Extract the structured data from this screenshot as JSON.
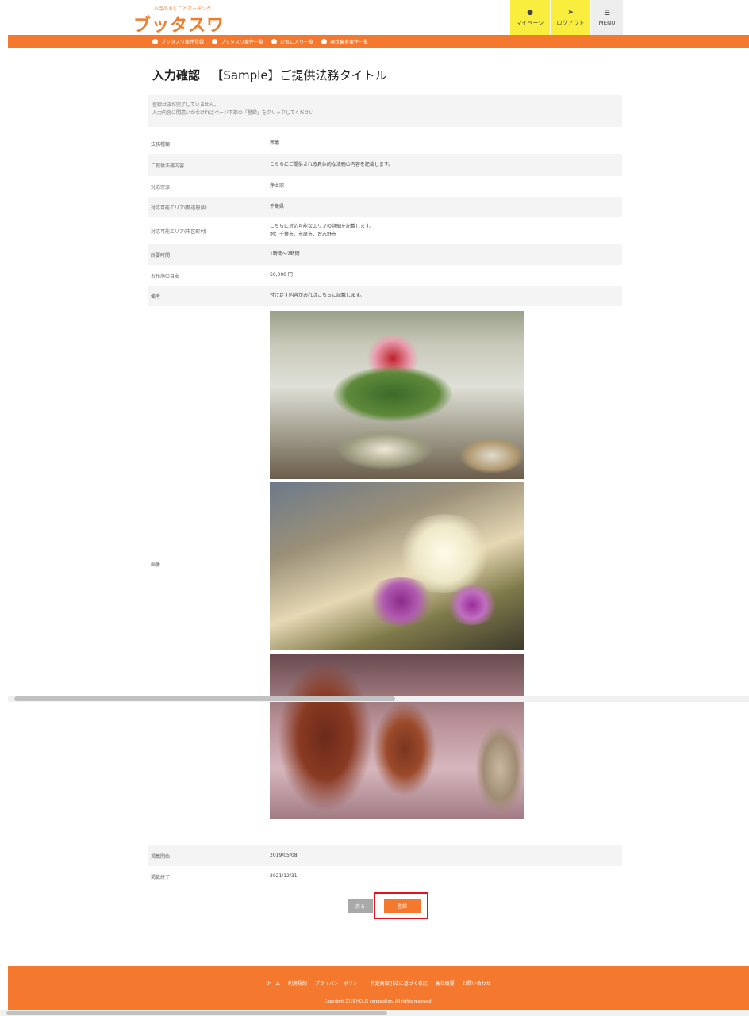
{
  "header": {
    "logo_tagline": "お寺のおしごとマッチング",
    "logo_text": "ブッタスワ",
    "mypage_label": "マイページ",
    "logout_label": "ログアウト",
    "menu_label": "MENU"
  },
  "nav": {
    "items": [
      {
        "label": "ブッタスワ案件登録"
      },
      {
        "label": "ブッタスワ案件一覧"
      },
      {
        "label": "お気に入り一覧"
      },
      {
        "label": "現状審査案件一覧"
      }
    ]
  },
  "page": {
    "title_prefix": "入力確認",
    "title_main": "【Sample】ご提供法務タイトル"
  },
  "notice": {
    "line1": "登録はまだ完了していません。",
    "line2": "入力内容に間違いがなければページ下部の「登録」をクリックしてください"
  },
  "table": {
    "rows": [
      {
        "label": "法務種類",
        "value": "葬儀"
      },
      {
        "label": "ご提供法務内容",
        "value": "こちらにご提供される具体的な法務の内容を記載します。"
      },
      {
        "label": "対応宗派",
        "value": "浄土宗"
      },
      {
        "label": "対応可能エリア(都道府県)",
        "value": "千葉県"
      },
      {
        "label": "対応可能エリア(市区町村)",
        "value": "こちらに対応可能なエリアの詳細を記載します。",
        "value2": "例：千葉市、市原市、習志野市"
      },
      {
        "label": "所要時間",
        "value": "1時間～2時間"
      },
      {
        "label": "お布施の目安",
        "value": "50,000 円"
      },
      {
        "label": "備考",
        "value": "付け足す内容があればこちらに記載します。"
      }
    ],
    "image_label": "画像",
    "images": [
      {
        "alt": "flower-arrangement-incense-photo"
      },
      {
        "alt": "lily-flower-arrangement-photo"
      },
      {
        "alt": "prayer-beads-photo"
      }
    ]
  },
  "dates": [
    {
      "label": "掲載開始",
      "value": "2019/05/08"
    },
    {
      "label": "掲載終了",
      "value": "2021/12/31"
    }
  ],
  "buttons": {
    "back": "戻る",
    "register": "登録"
  },
  "footer": {
    "links": [
      "ホーム",
      "利用規約",
      "プライバシーポリシー",
      "特定商取引法に基づく表記",
      "会社概要",
      "お問い合わせ"
    ],
    "copyright": "Copyright 2019 HOLIS corporation. All rights reserved."
  },
  "colors": {
    "brand_orange": "#f5782f",
    "header_yellow": "#f9ee3e",
    "highlight_red": "#e0141e"
  }
}
